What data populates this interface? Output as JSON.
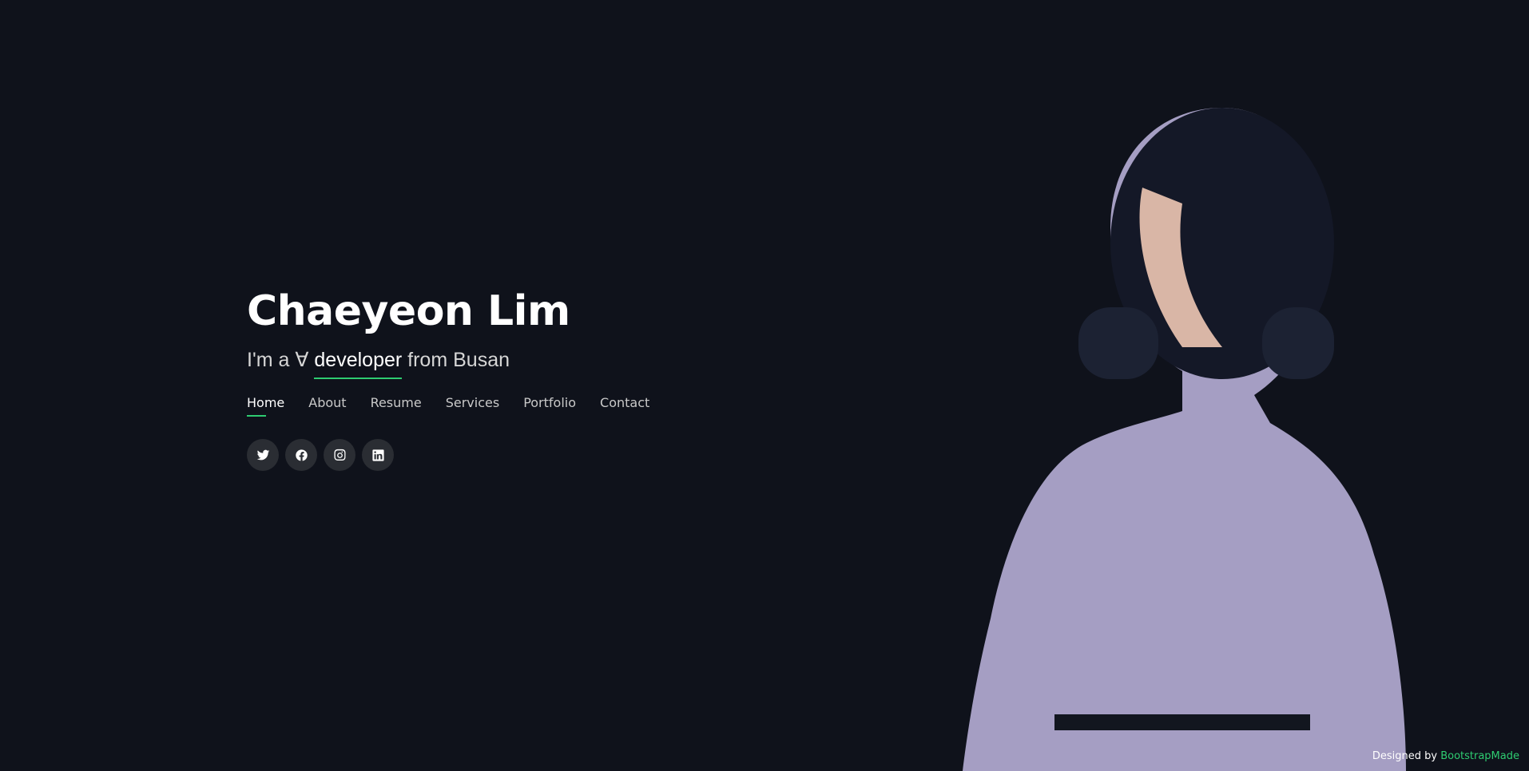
{
  "hero": {
    "name": "Chaeyeon Lim",
    "tagline_prefix": "I'm a ",
    "tagline_glyph": "∀",
    "tagline_typed": "developer",
    "tagline_suffix": " from Busan"
  },
  "nav": {
    "items": [
      {
        "label": "Home",
        "active": true
      },
      {
        "label": "About"
      },
      {
        "label": "Resume"
      },
      {
        "label": "Services"
      },
      {
        "label": "Portfolio"
      },
      {
        "label": "Contact"
      }
    ]
  },
  "social": {
    "icons": [
      "twitter-icon",
      "facebook-icon",
      "instagram-icon",
      "linkedin-icon"
    ]
  },
  "credits": {
    "prefix": "Designed by ",
    "link": "BootstrapMade"
  },
  "colors": {
    "background": "#0f121b",
    "accent": "#2ecc71"
  }
}
